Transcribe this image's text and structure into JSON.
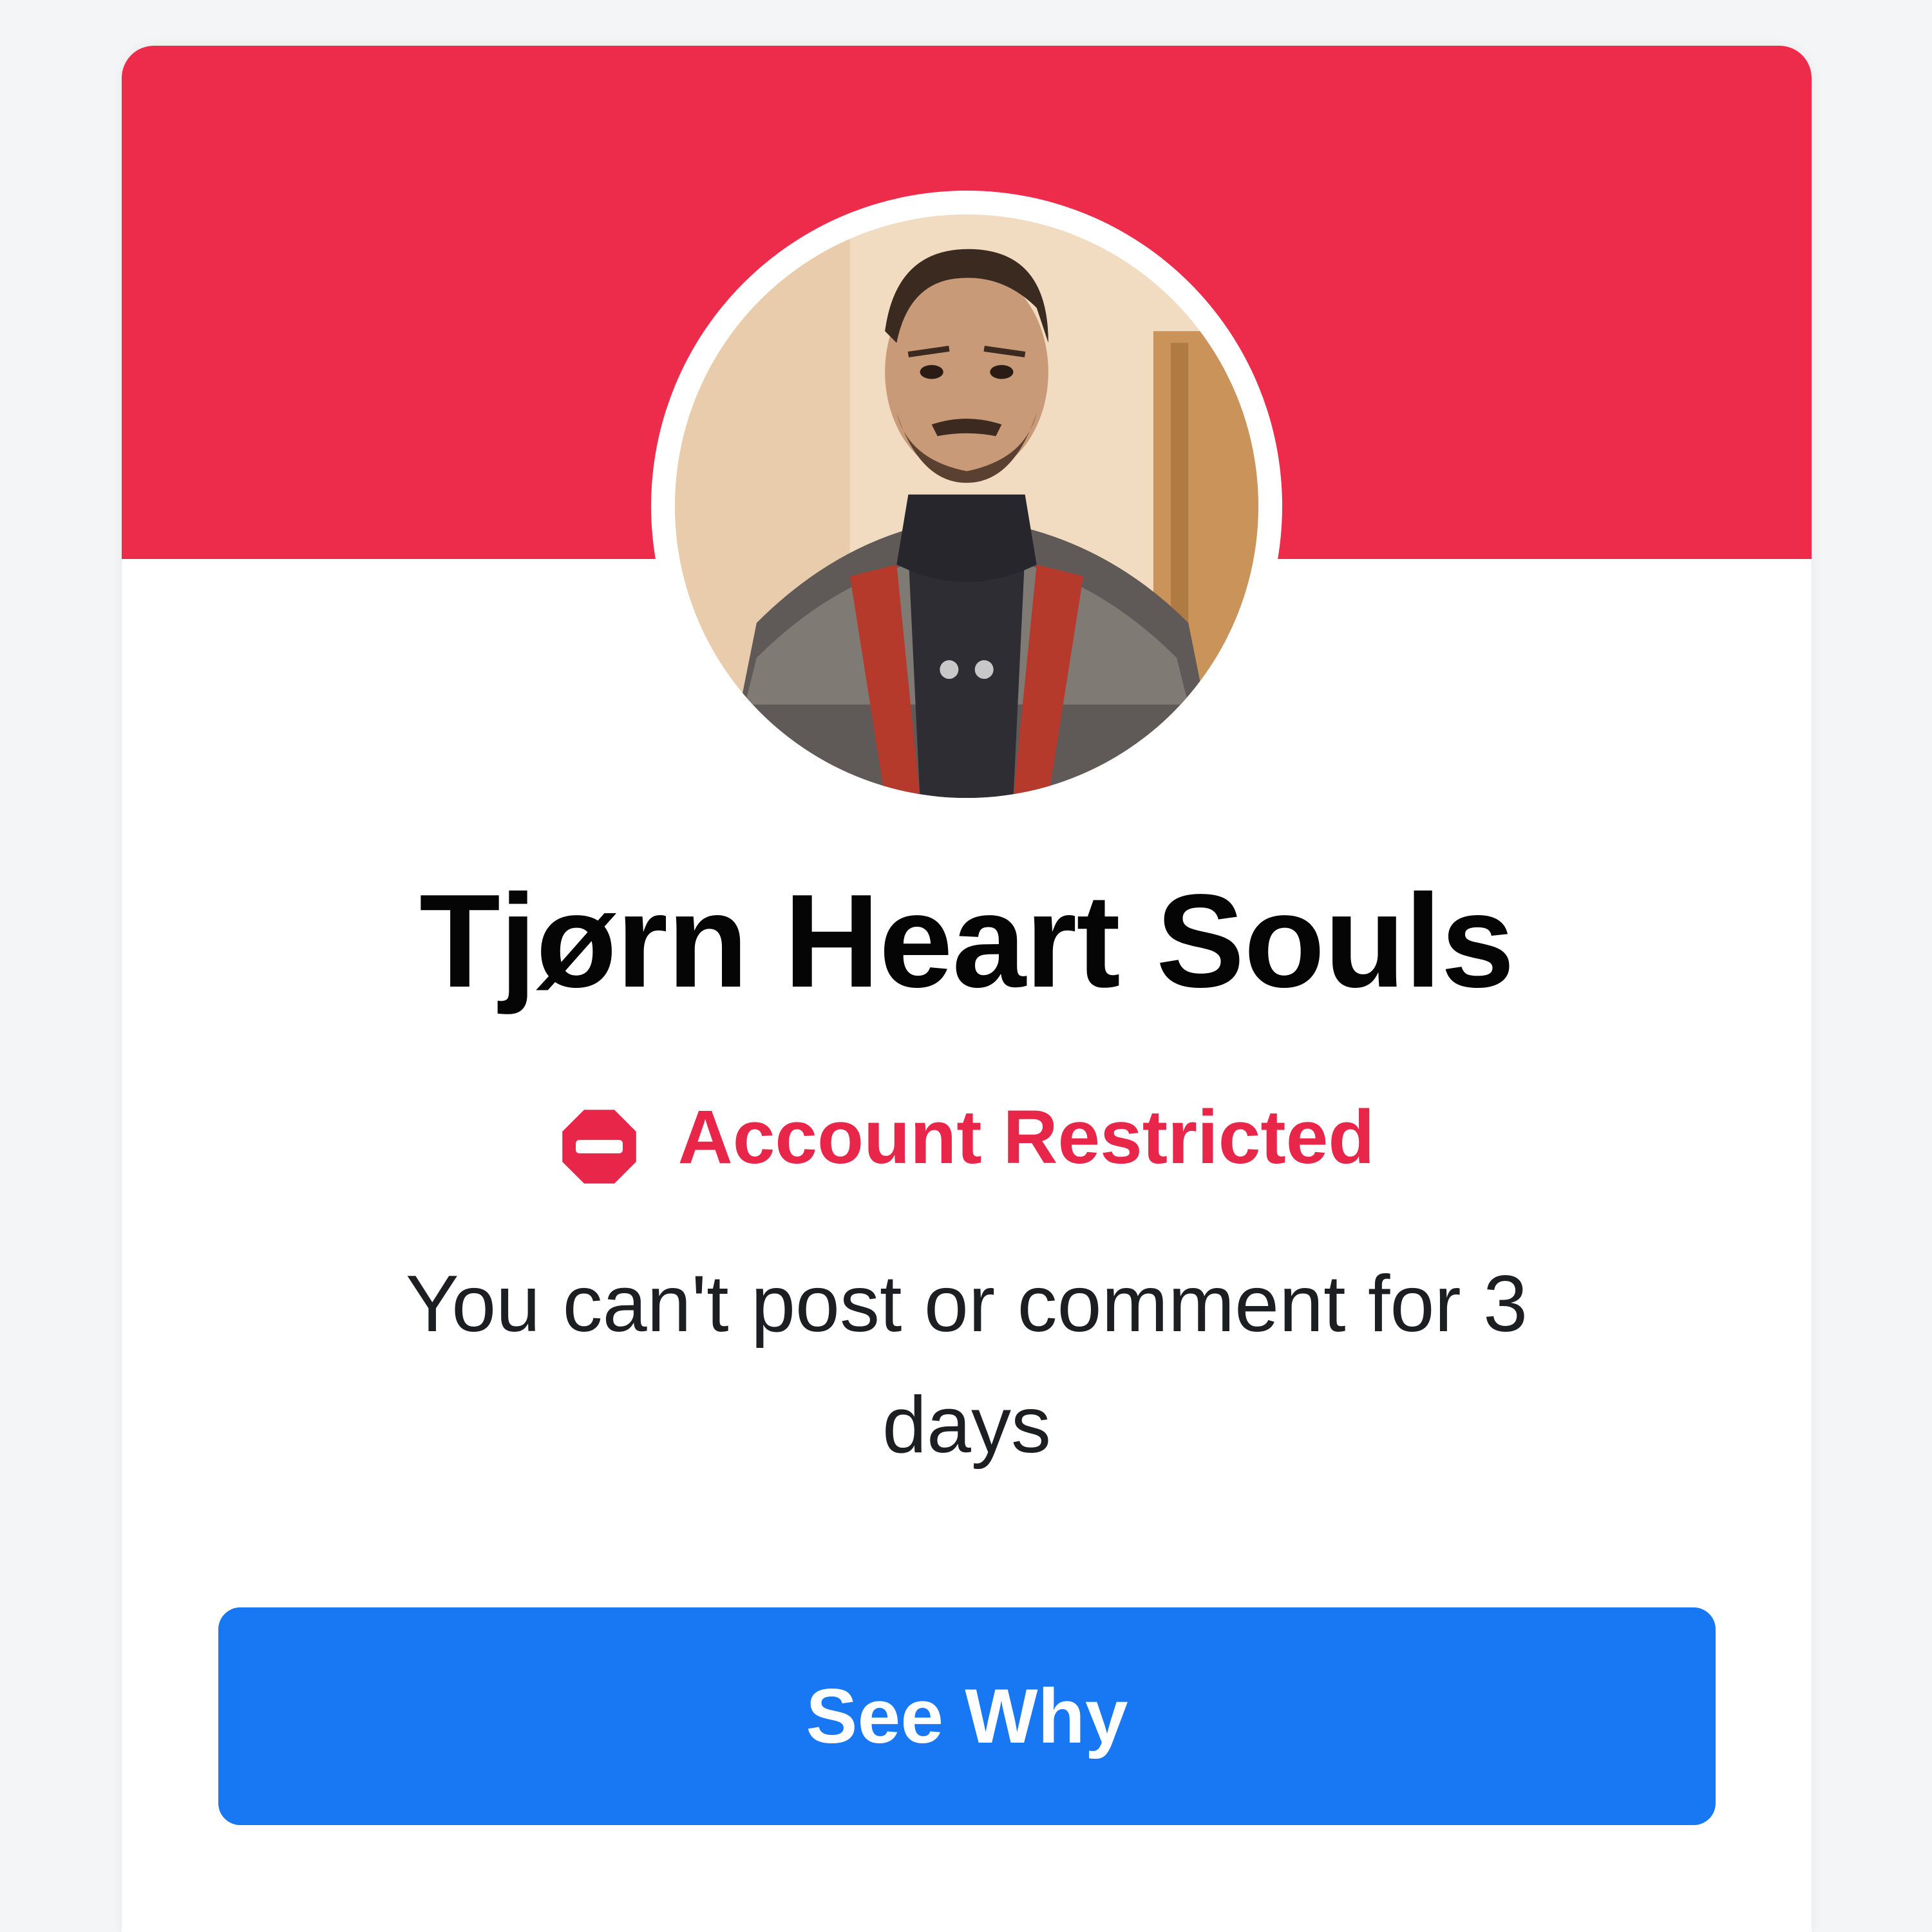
{
  "colors": {
    "banner": "#ed2b4b",
    "restricted": "#e8264a",
    "button": "#1877f2"
  },
  "profile": {
    "name": "Tjørn Heart Souls",
    "avatar_icon": "profile-photo"
  },
  "status": {
    "icon": "no-entry-icon",
    "label": "Account Restricted",
    "message": "You can't post or comment for 3 days"
  },
  "action": {
    "label": "See Why"
  }
}
